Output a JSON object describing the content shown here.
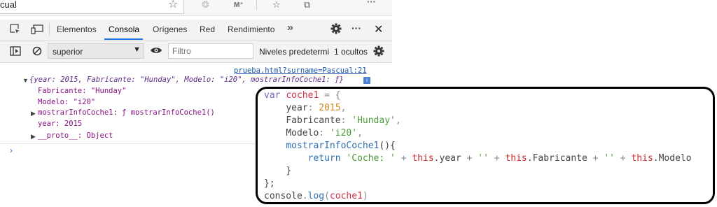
{
  "browser": {
    "address_text": "cual",
    "icons": [
      "star-icon",
      "extension-icon",
      "profile-icon",
      "favorites-icon",
      "collections-icon",
      "more-icon"
    ]
  },
  "devtools": {
    "tabs": [
      {
        "label": "Elementos"
      },
      {
        "label": "Consola",
        "active": true
      },
      {
        "label": "Orígenes"
      },
      {
        "label": "Red"
      },
      {
        "label": "Rendimiento"
      }
    ],
    "more_tabs": "»",
    "more_menu": "···",
    "close": "✕",
    "toolbar": {
      "context": "superior",
      "filter_placeholder": "Filtro",
      "levels": "Niveles predetermi",
      "hidden_count": "1 ocultos"
    }
  },
  "console": {
    "source_link": "prueba.html?surname=Pascual:21",
    "object_summary": "{year: 2015, Fabricante: \"Hunday\", Modelo: \"i20\", mostrarInfoCoche1: ƒ}",
    "info_badge": "i",
    "properties": [
      {
        "text": "Fabricante: \"Hunday\""
      },
      {
        "text": "Modelo: \"i20\""
      },
      {
        "text": "mostrarInfoCoche1: ƒ mostrarInfoCoche1()",
        "expandable": true
      },
      {
        "text": "year: 2015"
      },
      {
        "text": "__proto__: Object",
        "expandable": true
      }
    ],
    "prompt": "›"
  },
  "code": {
    "l1_kw": "var",
    "l1_name": "coche1",
    "l1_rest": " = {",
    "l2_key": "year",
    "l2_val": "2015",
    "l3_key": "Fabricante",
    "l3_val": "'Hunday'",
    "l4_key": "Modelo",
    "l4_val": "'i20'",
    "l5_fn": "mostrarInfoCoche1",
    "l5_rest": "(){",
    "l6_ret": "return",
    "l6_str1": "'Coche: '",
    "l6_this1": "this",
    "l6_p1": ".year",
    "l6_str2": "''",
    "l6_this2": "this",
    "l6_p2": ".Fabricante",
    "l6_str3": "''",
    "l6_this3": "this",
    "l6_p3": ".Modelo",
    "l7": "}",
    "l8": "};",
    "l9_obj": "console",
    "l9_fn": "log",
    "l9_arg": "coche1",
    "l9_close": ")"
  }
}
